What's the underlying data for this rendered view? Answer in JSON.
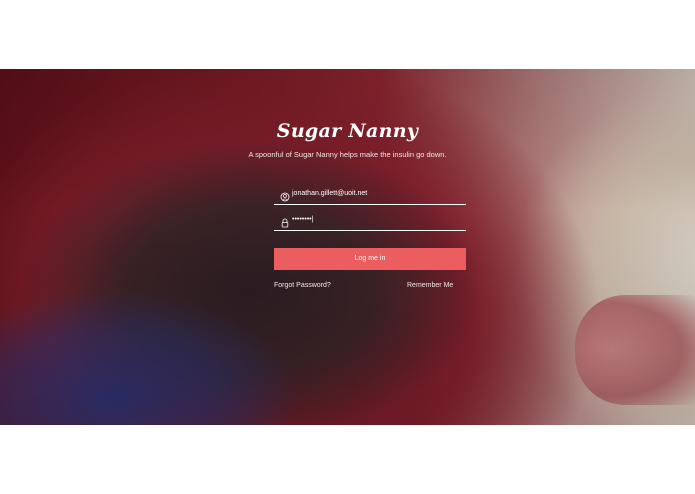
{
  "app": {
    "title": "Sugar Nanny",
    "tagline": "A spoonful of Sugar Nanny helps make the insulin go down."
  },
  "form": {
    "email_value": "jonathan.gillett@uoit.net",
    "password_mask": "••••••••|",
    "login_label": "Log me in",
    "forgot_label": "Forgot Password?",
    "remember_label": "Remember Me"
  },
  "icons": {
    "email": "user-circle-icon",
    "password": "lock-icon"
  },
  "colors": {
    "accent": "#ec5d5f",
    "text": "#ffffff"
  }
}
